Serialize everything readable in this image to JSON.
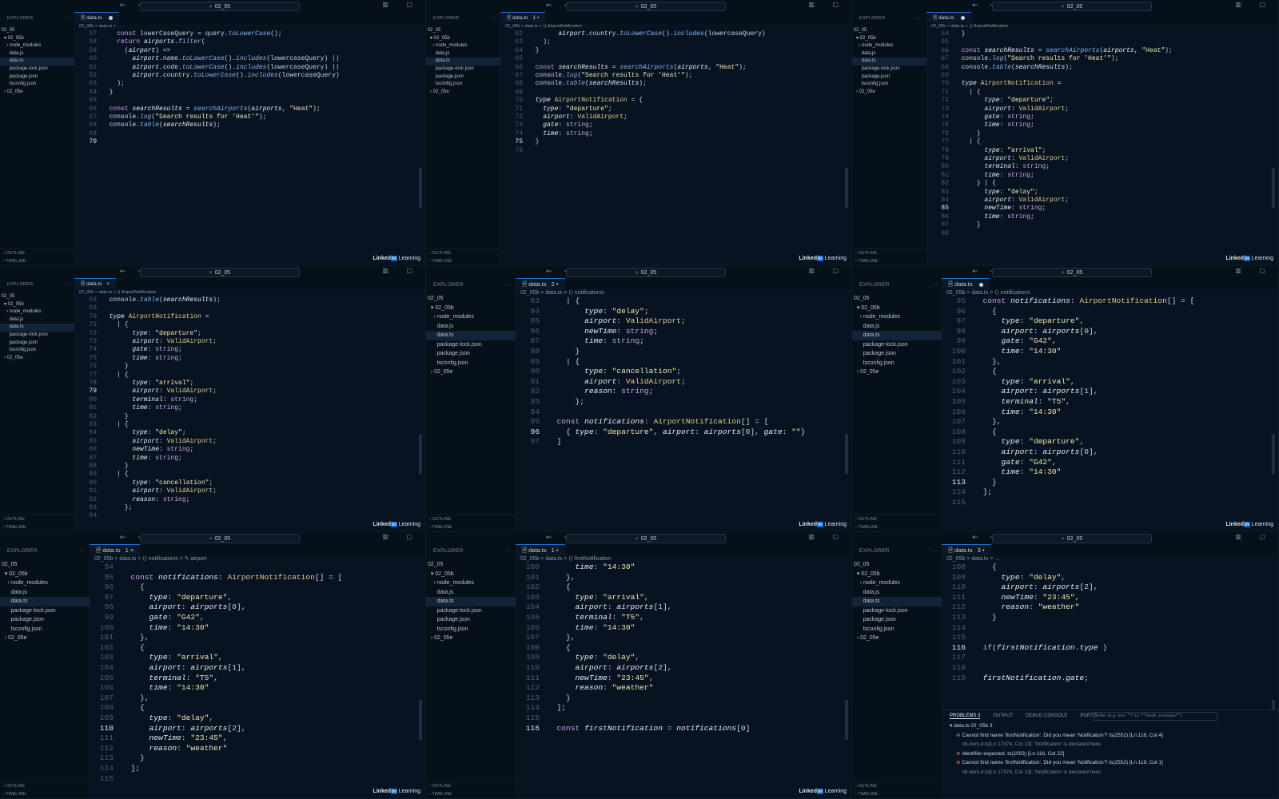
{
  "brand": {
    "linkedin": "Linked",
    "in_badge": "in",
    "learning": "Learning"
  },
  "common": {
    "explorer": "EXPLORER",
    "outline": "OUTLINE",
    "timeline": "TIMELINE",
    "search": "02_05",
    "nav_arrows": "← →",
    "dots": "···"
  },
  "panels": [
    {
      "tab": "data.ts",
      "tab_state": "dot",
      "breadcrumb": "02_05b  >  data.ts  >  ...",
      "tree": [
        [
          "02_05",
          ""
        ],
        [
          "  ▾ 02_05b",
          ""
        ],
        [
          "    › node_modules",
          ""
        ],
        [
          "      data.js",
          ""
        ],
        [
          "      data.ts",
          "sel"
        ],
        [
          "      package-lock.json",
          ""
        ],
        [
          "      package.json",
          ""
        ],
        [
          "      tsconfig.json",
          ""
        ],
        [
          "  › 02_05e",
          ""
        ]
      ],
      "start": 57,
      "cur": 70,
      "lines": [
        "    const lowerCaseQuery = query.toLowerCase();",
        "    return airports.filter(",
        "      (airport) =>",
        "        airport.name.toLowerCase().includes(lowercaseQuery) ||",
        "        airport.code.toLowerCase().includes(lowercaseQuery) ||",
        "        airport.country.toLowerCase().includes(lowercaseQuery)",
        "    );",
        "  }",
        "",
        "  const searchResults = searchAirports(airports, \"Heat\");",
        "  console.log(\"Search results for 'Heat'\");",
        "  console.table(searchResults);",
        "",
        ""
      ]
    },
    {
      "tab": "data.ts",
      "tab_state": "1 •",
      "breadcrumb": "02_05b  >  data.ts  >  ⟨⟩ AirportNotification",
      "tree": [
        [
          "02_05",
          ""
        ],
        [
          "  ▾ 02_05b",
          ""
        ],
        [
          "    › node_modules",
          ""
        ],
        [
          "      data.js",
          ""
        ],
        [
          "      data.ts",
          "sel"
        ],
        [
          "      package-lock.json",
          ""
        ],
        [
          "      package.json",
          ""
        ],
        [
          "      tsconfig.json",
          ""
        ],
        [
          "  › 02_05e",
          ""
        ]
      ],
      "start": 62,
      "cur": 75,
      "lines": [
        "        airport.country.toLowerCase().includes(lowercaseQuery)",
        "    );",
        "  }",
        "",
        "  const searchResults = searchAirports(airports, \"Heat\");",
        "  console.log(\"Search results for 'Heat'\");",
        "  console.table(searchResults);",
        "",
        "  type AirportNotification = {",
        "    type: \"departure\";",
        "    airport: ValidAirport;",
        "    gate: string;",
        "    time: string;",
        "  }",
        ""
      ]
    },
    {
      "tab": "data.ts",
      "tab_state": "dot",
      "breadcrumb": "02_05b  >  data.ts  >  ⟨⟩ AirportNotification",
      "tree": [
        [
          "02_05",
          ""
        ],
        [
          "  ▾ 02_05b",
          ""
        ],
        [
          "    › node_modules",
          ""
        ],
        [
          "      data.js",
          ""
        ],
        [
          "      data.ts",
          "sel"
        ],
        [
          "      package-lock.json",
          ""
        ],
        [
          "      package.json",
          ""
        ],
        [
          "      tsconfig.json",
          ""
        ],
        [
          "  › 02_05e",
          ""
        ]
      ],
      "start": 64,
      "cur": 85,
      "lines": [
        "  }",
        "",
        "  const searchResults = searchAirports(airports, \"Heat\");",
        "  console.log(\"Search results for 'Heat'\");",
        "  console.table(searchResults);",
        "",
        "  type AirportNotification =",
        "    | {",
        "        type: \"departure\";",
        "        airport: ValidAirport;",
        "        gate: string;",
        "        time: string;",
        "      }",
        "    | {",
        "        type: \"arrival\";",
        "        airport: ValidAirport;",
        "        terminal: string;",
        "        time: string;",
        "      } | {",
        "        type: \"delay\";",
        "        airport: ValidAirport;",
        "        newTime: string;",
        "        time: string;",
        "      }",
        ""
      ]
    },
    {
      "tab": "data.ts",
      "tab_state": "×",
      "breadcrumb": "02_05b  >  data.ts  >  ⟨⟩ AirportNotification",
      "tree": [
        [
          "02_05",
          ""
        ],
        [
          "  ▾ 02_05b",
          ""
        ],
        [
          "    › node_modules",
          ""
        ],
        [
          "      data.js",
          ""
        ],
        [
          "      data.ts",
          "sel"
        ],
        [
          "      package-lock.json",
          ""
        ],
        [
          "      package.json",
          ""
        ],
        [
          "      tsconfig.json",
          ""
        ],
        [
          "  › 02_05e",
          ""
        ]
      ],
      "start": 68,
      "cur": 79,
      "lines": [
        "  console.table(searchResults);",
        "",
        "  type AirportNotification =",
        "    | {",
        "        type: \"departure\";",
        "        airport: ValidAirport;",
        "        gate: string;",
        "        time: string;",
        "      }",
        "    | {",
        "        type: \"arrival\";",
        "        airport: ValidAirport;",
        "        terminal: string;",
        "        time: string;",
        "      }",
        "    | {",
        "        type: \"delay\";",
        "        airport: ValidAirport;",
        "        newTime: string;",
        "        time: string;",
        "      }",
        "    | {",
        "        type: \"cancellation\";",
        "        airport: ValidAirport;",
        "        reason: string;",
        "      };",
        ""
      ]
    },
    {
      "tab": "data.ts",
      "tab_state": "2 •",
      "breadcrumb": "02_05b  >  data.ts  >  ⟨⟩ notifications",
      "tree": [
        [
          "02_05",
          ""
        ],
        [
          "  ▾ 02_05b",
          ""
        ],
        [
          "    › node_modules",
          ""
        ],
        [
          "      data.js",
          ""
        ],
        [
          "      data.ts",
          "sel"
        ],
        [
          "      package-lock.json",
          ""
        ],
        [
          "      package.json",
          ""
        ],
        [
          "      tsconfig.json",
          ""
        ],
        [
          "  › 02_05e",
          ""
        ]
      ],
      "start": 83,
      "cur": 96,
      "lines": [
        "    | {",
        "        type: \"delay\";",
        "        airport: ValidAirport;",
        "        newTime: string;",
        "        time: string;",
        "      }",
        "    | {",
        "        type: \"cancellation\";",
        "        airport: ValidAirport;",
        "        reason: string;",
        "      };",
        "",
        "  const notifications: AirportNotification[] = [",
        "    { type: \"departure\", airport: airports[0], gate: \"\"}",
        "  ]"
      ]
    },
    {
      "tab": "data.ts",
      "tab_state": "dot",
      "breadcrumb": "02_05b  >  data.ts  >  ⟨⟩ notifications",
      "tree": [
        [
          "02_05",
          ""
        ],
        [
          "  ▾ 02_05b",
          ""
        ],
        [
          "    › node_modules",
          ""
        ],
        [
          "      data.js",
          ""
        ],
        [
          "      data.ts",
          "sel"
        ],
        [
          "      package-lock.json",
          ""
        ],
        [
          "      package.json",
          ""
        ],
        [
          "      tsconfig.json",
          ""
        ],
        [
          "  › 02_05e",
          ""
        ]
      ],
      "start": 95,
      "cur": 113,
      "lines": [
        "  const notifications: AirportNotification[] = [",
        "    {",
        "      type: \"departure\",",
        "      airport: airports[0],",
        "      gate: \"G42\",",
        "      time: \"14:30\"",
        "    },",
        "    {",
        "      type: \"arrival\",",
        "      airport: airports[1],",
        "      terminal: \"T5\",",
        "      time: \"14:30\"",
        "    },",
        "    {",
        "      type: \"departure\",",
        "      airport: airports[0],",
        "      gate: \"G42\",",
        "      time: \"14:30\"",
        "    }",
        "  ];",
        ""
      ]
    },
    {
      "tab": "data.ts",
      "tab_state": "1 ×",
      "breadcrumb": "02_05b  >  data.ts  >  ⟨⟩ notifications  >  ✎ airport",
      "tree": [
        [
          "02_05",
          ""
        ],
        [
          "  ▾ 02_05b",
          ""
        ],
        [
          "    › node_modules",
          ""
        ],
        [
          "      data.js",
          ""
        ],
        [
          "      data.ts",
          "sel"
        ],
        [
          "      package-lock.json",
          ""
        ],
        [
          "      package.json",
          ""
        ],
        [
          "      tsconfig.json",
          ""
        ],
        [
          "  › 02_05e",
          ""
        ]
      ],
      "start": 94,
      "cur": 110,
      "lines": [
        "",
        "  const notifications: AirportNotification[] = [",
        "    {",
        "      type: \"departure\",",
        "      airport: airports[0],",
        "      gate: \"G42\",",
        "      time: \"14:30\"",
        "    },",
        "    {",
        "      type: \"arrival\",",
        "      airport: airports[1],",
        "      terminal: \"T5\",",
        "      time: \"14:30\"",
        "    },",
        "    {",
        "      type: \"delay\",",
        "      airport: airports[2],",
        "      newTime: \"23:45\",",
        "      reason: \"weather\"",
        "    }",
        "  ];",
        ""
      ]
    },
    {
      "tab": "data.ts",
      "tab_state": "1 •",
      "breadcrumb": "02_05b  >  data.ts  >  ⟨⟩ firstNotification",
      "tree": [
        [
          "02_05",
          ""
        ],
        [
          "  ▾ 02_05b",
          ""
        ],
        [
          "    › node_modules",
          ""
        ],
        [
          "      data.js",
          ""
        ],
        [
          "      data.ts",
          "sel"
        ],
        [
          "      package-lock.json",
          ""
        ],
        [
          "      package.json",
          ""
        ],
        [
          "      tsconfig.json",
          ""
        ],
        [
          "  › 02_05e",
          ""
        ]
      ],
      "start": 100,
      "cur": 116,
      "lines": [
        "      time: \"14:30\"",
        "    },",
        "    {",
        "      type: \"arrival\",",
        "      airport: airports[1],",
        "      terminal: \"T5\",",
        "      time: \"14:30\"",
        "    },",
        "    {",
        "      type: \"delay\",",
        "      airport: airports[2],",
        "      newTime: \"23:45\",",
        "      reason: \"weather\"",
        "    }",
        "  ];",
        "",
        "  const firstNotification = notifications[0]"
      ]
    },
    {
      "tab": "data.ts",
      "tab_state": "3 •",
      "breadcrumb": "02_05b  >  data.ts  >  ...",
      "tree": [
        [
          "02_05",
          ""
        ],
        [
          "  ▾ 02_05b",
          ""
        ],
        [
          "    › node_modules",
          ""
        ],
        [
          "      data.js",
          ""
        ],
        [
          "      data.ts",
          "sel"
        ],
        [
          "      package-lock.json",
          ""
        ],
        [
          "      package.json",
          ""
        ],
        [
          "      tsconfig.json",
          ""
        ],
        [
          "  › 02_05e",
          ""
        ]
      ],
      "start": 108,
      "cur": 116,
      "lines": [
        "    {",
        "      type: \"delay\",",
        "      airport: airports[2],",
        "      newTime: \"23:45\",",
        "      reason: \"weather\"",
        "    }",
        "",
        "",
        "  if(firstNotification.type )",
        "",
        "",
        "  firstNotification.gate;"
      ],
      "problems": {
        "tabs": [
          "PROBLEMS 3",
          "OUTPUT",
          "DEBUG CONSOLE",
          "PORTS"
        ],
        "filter": "Filter (e.g. text, **/*.ts, !**/node_modules/**)",
        "file": "data.ts  02_05b  3",
        "rows": [
          {
            "err": true,
            "text": "Cannot find name 'firstNotification'. Did you mean 'Notification'?  ts(2552)  [Ln 116, Col 4]"
          },
          {
            "err": false,
            "text": "lib.dom.d.ts[Ln 17374, Col 13]: 'Notification' is declared here."
          },
          {
            "err": true,
            "text": "Identifier expected.  ts(1003)  [Ln 116, Col 22]"
          },
          {
            "err": true,
            "text": "Cannot find name 'firstNotification'. Did you mean 'Notification'?  ts(2552)  [Ln 119, Col 1]"
          },
          {
            "err": false,
            "text": "lib.dom.d.ts[Ln 17374, Col 13]: 'Notification' is declared here."
          }
        ]
      }
    }
  ]
}
